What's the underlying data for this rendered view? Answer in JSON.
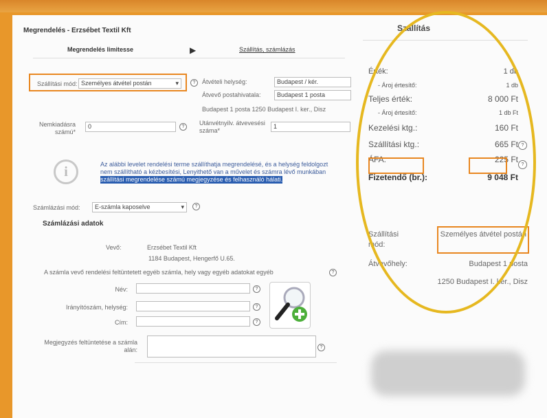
{
  "breadcrumb": "Megrendelés - Erzsébet Textil Kft",
  "steps": {
    "step1": "Megrendelés limitesse",
    "step2": "Szállítás, számlázás"
  },
  "shipping": {
    "method_label": "Szállítási mód:",
    "method_value": "Személyes átvétel postán",
    "pickup_label": "Átvételi helység:",
    "pickup_value": "Budapest / kér.",
    "office_label": "Átvevő postahivatala:",
    "office_value": "Budapest 1 posta",
    "address_line": "Budapest 1 posta 1250 Budapest I. ker., Disz",
    "vat_label": "Nemkiadásra számú*",
    "vat_value": "0",
    "reg_label": "Utánvétnyilv. átvevesési száma*",
    "reg_value": "1"
  },
  "notice": {
    "line1": "Az alábbi levelet rendelési terme szállíthatja megrendelésé, és a helység feldolgozt",
    "line2": "nem szállítható a kézbesítési, Lenyithető van a művelet és számra lévő munkában",
    "highlight": "szállítási megrendelése számú megjegyzése és felhasználó hálati."
  },
  "billing": {
    "method_label": "Számlázási mód:",
    "method_value": "E-számla kaposelve",
    "section_title": "Számlázási adatok",
    "buyer_label": "Vevő:",
    "buyer_name": "Erzsébet Textil Kft",
    "buyer_address": "1184 Budapest, Hengerfő U.65.",
    "instruction": "A számla vevő rendelési feltüntetett egyéb számla, hely vagy egyéb adatokat egyéb",
    "fields": {
      "name": "Név:",
      "address": "Irányítószám, helység:",
      "street": "Cím:",
      "note": "Megjegyzés feltüntetése a számla alán:"
    }
  },
  "summary": {
    "title": "Szállítás",
    "rows": [
      {
        "label": "Érték:",
        "value": "1 db"
      },
      {
        "label": "- Ároj értesítő:",
        "value": "1 db"
      },
      {
        "label": "Teljes érték:",
        "value": "8 000 Ft"
      },
      {
        "label": "- Ároj értesítő:",
        "value": "1 db Ft"
      },
      {
        "label": "Kezelési ktg.:",
        "value": "160 Ft"
      },
      {
        "label": "Szállítási ktg.:",
        "value": "665 Ft"
      },
      {
        "label": "ÁFA:",
        "value": "225 Ft"
      }
    ],
    "total_label": "Fizetendő (br.):",
    "total_value": "9 048 Ft",
    "method_label": "Szállítási mód:",
    "method_value": "Személyes átvétel postán",
    "receipt_label": "Átvevőhely:",
    "receipt_value": "Budapest 1 posta",
    "receipt_address": "1250 Budapest I. ker., Disz"
  },
  "colors": {
    "accent": "#e8861f",
    "highlight": "#2a5db0",
    "circle": "#e6b820"
  }
}
